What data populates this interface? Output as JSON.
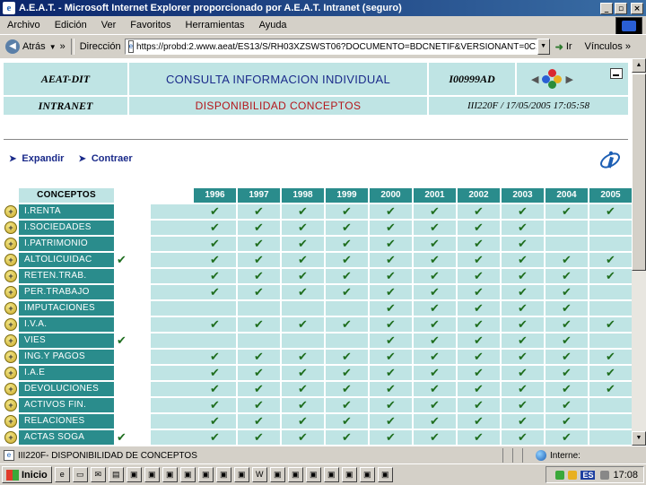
{
  "window": {
    "title": "A.E.A.T. - Microsoft Internet Explorer proporcionado por A.E.A.T. Intranet (seguro)",
    "minimize_glyph": "_",
    "maximize_glyph": "▫",
    "close_glyph": "×"
  },
  "menu": [
    "Archivo",
    "Edición",
    "Ver",
    "Favoritos",
    "Herramientas",
    "Ayuda"
  ],
  "toolbar": {
    "back_label": "Atrás",
    "chevron": "»",
    "address_label": "Dirección",
    "url": "https://probd:2.www.aeat/ES13/S/RH03XZSWST06?DOCUMENTO=BDCNETIF&VERSIONANT=0C1&T",
    "go_label": "Ir",
    "links_label": "Vínculos",
    "links_chevron": "»"
  },
  "header": {
    "org": "AEAT-DIT",
    "network": "INTRANET",
    "title": "CONSULTA INFORMACION INDIVIDUAL",
    "subtitle": "DISPONIBILIDAD CONCEPTOS",
    "code": "I00999AD",
    "screen_date": "III220F / 17/05/2005 17:05:58"
  },
  "actions": {
    "expand": "Expandir",
    "collapse": "Contraer"
  },
  "table": {
    "concepts_header": "CONCEPTOS",
    "years": [
      "1996",
      "1997",
      "1998",
      "1999",
      "2000",
      "2001",
      "2002",
      "2003",
      "2004",
      "2005"
    ],
    "check_glyph": "✔",
    "expand_glyph": "+",
    "rows": [
      {
        "name": "I.RENTA",
        "extra": "",
        "cells": [
          "✔",
          "✔",
          "✔",
          "✔",
          "✔",
          "✔",
          "✔",
          "✔",
          "✔",
          "✔"
        ]
      },
      {
        "name": "I.SOCIEDADES",
        "extra": "",
        "cells": [
          "✔",
          "✔",
          "✔",
          "✔",
          "✔",
          "✔",
          "✔",
          "✔",
          "",
          ""
        ]
      },
      {
        "name": "I.PATRIMONIO",
        "extra": "",
        "cells": [
          "✔",
          "✔",
          "✔",
          "✔",
          "✔",
          "✔",
          "✔",
          "✔",
          "",
          ""
        ]
      },
      {
        "name": "ALTOLICUIDAC",
        "extra": "✔",
        "cells": [
          "✔",
          "✔",
          "✔",
          "✔",
          "✔",
          "✔",
          "✔",
          "✔",
          "✔",
          "✔"
        ]
      },
      {
        "name": "RETEN.TRAB.",
        "extra": "",
        "cells": [
          "✔",
          "✔",
          "✔",
          "✔",
          "✔",
          "✔",
          "✔",
          "✔",
          "✔",
          "✔"
        ]
      },
      {
        "name": "PER.TRABAJO",
        "extra": "",
        "cells": [
          "✔",
          "✔",
          "✔",
          "✔",
          "✔",
          "✔",
          "✔",
          "✔",
          "✔",
          ""
        ]
      },
      {
        "name": "IMPUTACIONES",
        "extra": "",
        "cells": [
          "",
          "",
          "",
          "",
          "✔",
          "✔",
          "✔",
          "✔",
          "✔",
          ""
        ]
      },
      {
        "name": "I.V.A.",
        "extra": "",
        "cells": [
          "✔",
          "✔",
          "✔",
          "✔",
          "✔",
          "✔",
          "✔",
          "✔",
          "✔",
          "✔"
        ]
      },
      {
        "name": "VIES",
        "extra": "✔",
        "cells": [
          "",
          "",
          "",
          "",
          "✔",
          "✔",
          "✔",
          "✔",
          "✔",
          ""
        ]
      },
      {
        "name": "ING.Y PAGOS",
        "extra": "",
        "cells": [
          "✔",
          "✔",
          "✔",
          "✔",
          "✔",
          "✔",
          "✔",
          "✔",
          "✔",
          "✔"
        ]
      },
      {
        "name": "I.A.E",
        "extra": "",
        "cells": [
          "✔",
          "✔",
          "✔",
          "✔",
          "✔",
          "✔",
          "✔",
          "✔",
          "✔",
          "✔"
        ]
      },
      {
        "name": "DEVOLUCIONES",
        "extra": "",
        "cells": [
          "✔",
          "✔",
          "✔",
          "✔",
          "✔",
          "✔",
          "✔",
          "✔",
          "✔",
          "✔"
        ]
      },
      {
        "name": "ACTIVOS FIN.",
        "extra": "",
        "cells": [
          "✔",
          "✔",
          "✔",
          "✔",
          "✔",
          "✔",
          "✔",
          "✔",
          "✔",
          ""
        ]
      },
      {
        "name": "RELACIONES",
        "extra": "",
        "cells": [
          "✔",
          "✔",
          "✔",
          "✔",
          "✔",
          "✔",
          "✔",
          "✔",
          "✔",
          ""
        ]
      },
      {
        "name": "ACTAS SOGA",
        "extra": "✔",
        "cells": [
          "✔",
          "✔",
          "✔",
          "✔",
          "✔",
          "✔",
          "✔",
          "✔",
          "✔",
          ""
        ]
      }
    ]
  },
  "status": {
    "text": "III220F- DISPONIBILIDAD DE CONCEPTOS",
    "zone": "Interne:"
  },
  "taskbar": {
    "start_label": "Inicio",
    "lang": "ES",
    "clock": "17:08"
  },
  "colors": {
    "header_cell": "#bfe4e4",
    "concept_cell": "#2a8c8c",
    "check": "#1f6e1f",
    "title_blue": "#1a2a8a",
    "subtitle_red": "#b4161b"
  }
}
